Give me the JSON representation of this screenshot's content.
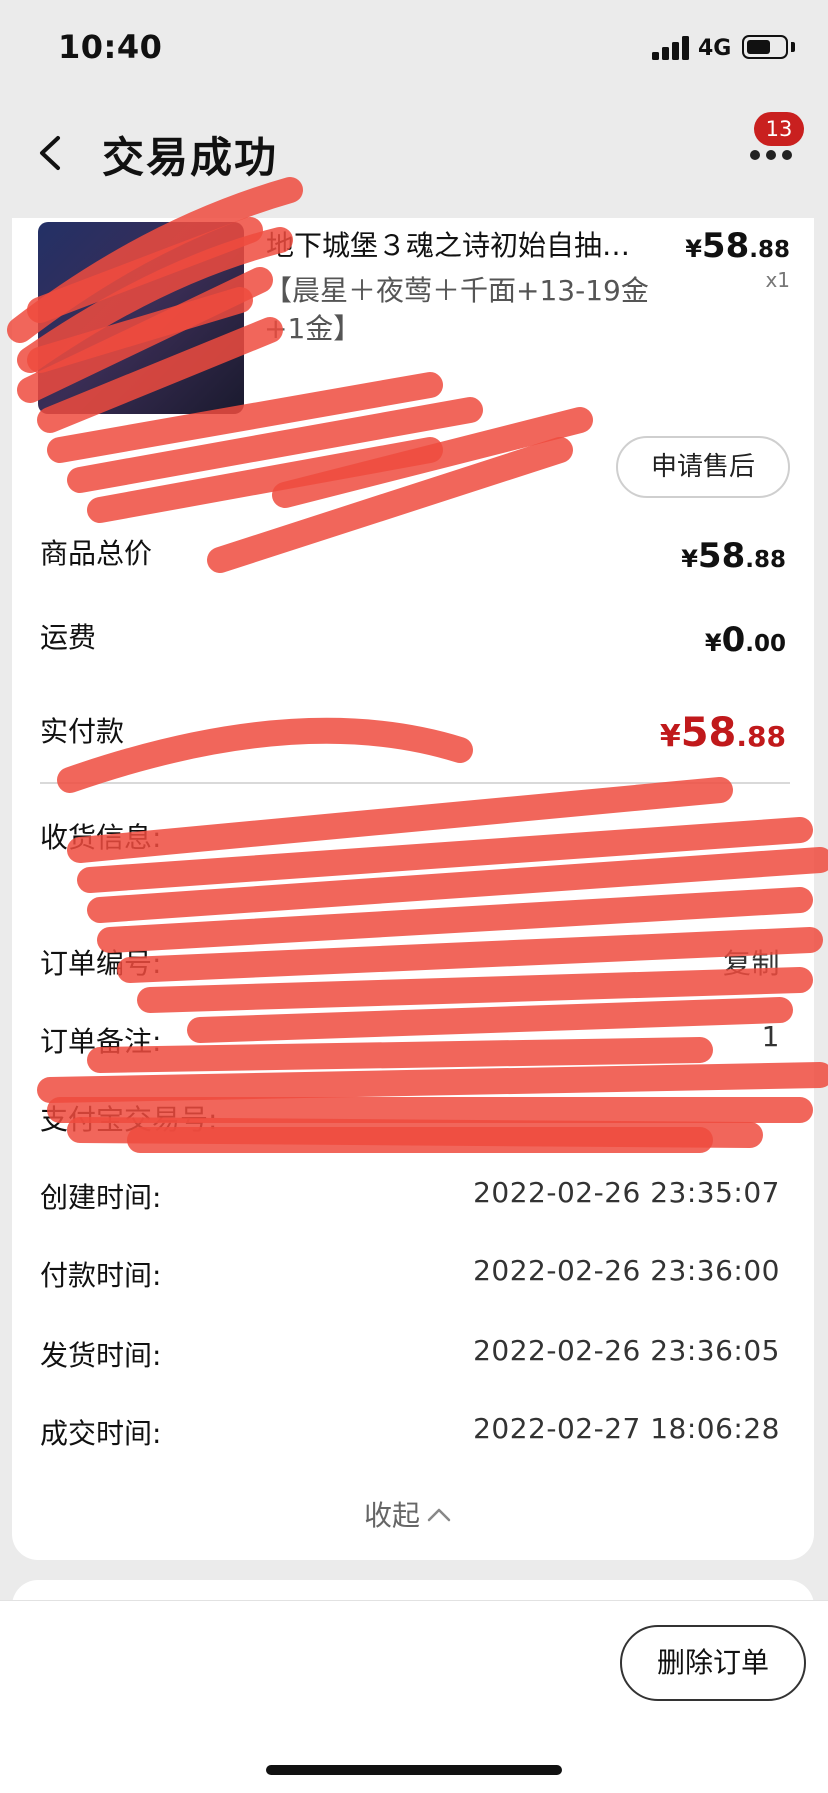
{
  "status_bar": {
    "time": "10:40",
    "network": "4G",
    "battery_level": 0.55
  },
  "nav": {
    "title": "交易成功",
    "badge_count": "13"
  },
  "product": {
    "title": "地下城堡３魂之诗初始自抽…",
    "spec": "【晨星＋夜莺＋千面+13-19金+1金】",
    "price": {
      "symbol": "¥",
      "integer": "58",
      "decimal": ".88"
    },
    "quantity": "x1",
    "after_sale_label": "申请售后"
  },
  "summary": {
    "goods_total": {
      "label": "商品总价",
      "symbol": "¥",
      "integer": "58",
      "decimal": ".88"
    },
    "shipping": {
      "label": "运费",
      "symbol": "¥",
      "integer": "0",
      "decimal": ".00"
    },
    "paid": {
      "label": "实付款",
      "symbol": "¥",
      "integer": "58",
      "decimal": ".88"
    }
  },
  "info": {
    "receiver_label": "收货信息:",
    "order_no_label": "订单编号:",
    "copy_label": "复制",
    "remark_label": "订单备注:",
    "remark_value": "1",
    "payment_label": "支付宝交易号:",
    "created_label": "创建时间:",
    "created_value": "2022-02-26 23:35:07",
    "paid_label": "付款时间:",
    "paid_value": "2022-02-26 23:36:00",
    "shipped_label": "发货时间:",
    "shipped_value": "2022-02-26 23:36:05",
    "completed_label": "成交时间:",
    "completed_value": "2022-02-27 18:06:28"
  },
  "collapse_label": "收起",
  "bottom": {
    "delete_label": "删除订单"
  },
  "colors": {
    "accent_red": "#c0191b",
    "badge_red": "#c9201f",
    "redaction": "#ee4b3e"
  }
}
